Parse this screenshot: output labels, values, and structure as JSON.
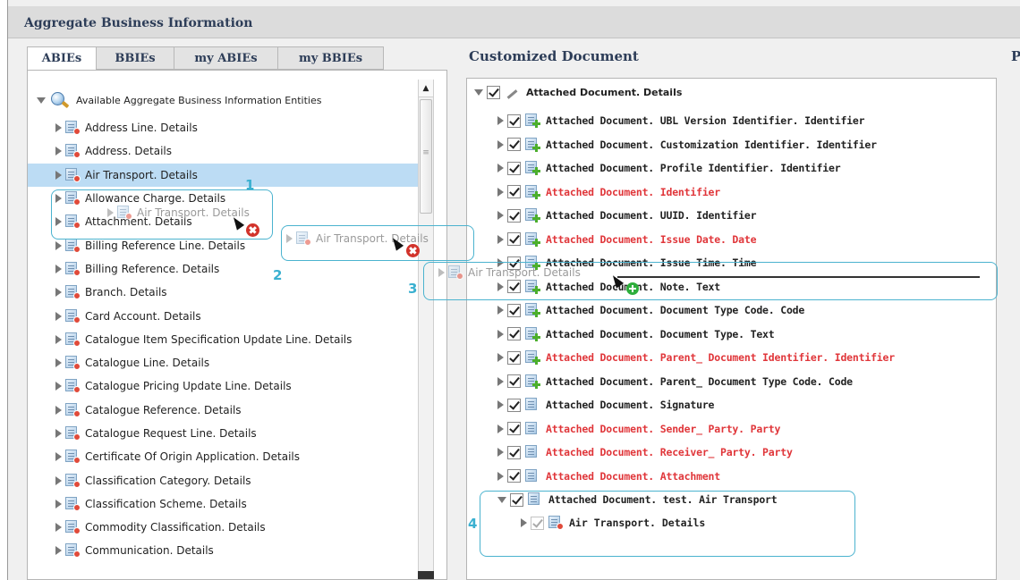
{
  "header": {
    "title": "Aggregate Business Information"
  },
  "tabs": [
    {
      "label": "ABIEs",
      "active": true
    },
    {
      "label": "BBIEs",
      "active": false
    },
    {
      "label": "my ABIEs",
      "active": false
    },
    {
      "label": "my BBIEs",
      "active": false
    }
  ],
  "left_tree": {
    "root_label": "Available Aggregate Business Information Entities",
    "items": [
      {
        "label": "Address Line. Details"
      },
      {
        "label": "Address. Details"
      },
      {
        "label": "Air Transport. Details",
        "selected": true
      },
      {
        "label": "Allowance Charge. Details"
      },
      {
        "label": "Attachment. Details"
      },
      {
        "label": "Billing Reference Line. Details"
      },
      {
        "label": "Billing Reference. Details"
      },
      {
        "label": "Branch. Details"
      },
      {
        "label": "Card Account. Details"
      },
      {
        "label": "Catalogue Item Specification Update Line. Details"
      },
      {
        "label": "Catalogue Line. Details"
      },
      {
        "label": "Catalogue Pricing Update Line. Details"
      },
      {
        "label": "Catalogue Reference. Details"
      },
      {
        "label": "Catalogue Request Line. Details"
      },
      {
        "label": "Certificate Of Origin Application. Details"
      },
      {
        "label": "Classification Category. Details"
      },
      {
        "label": "Classification Scheme. Details"
      },
      {
        "label": "Commodity Classification. Details"
      },
      {
        "label": "Communication. Details"
      }
    ]
  },
  "right_panel": {
    "title": "Customized Document",
    "edge_title": "P",
    "root_label": "Attached Document. Details",
    "items": [
      {
        "label": "Attached Document. UBL Version Identifier. Identifier",
        "required": false
      },
      {
        "label": "Attached Document. Customization Identifier. Identifier",
        "required": false
      },
      {
        "label": "Attached Document. Profile Identifier. Identifier",
        "required": false
      },
      {
        "label": "Attached Document. Identifier",
        "required": true
      },
      {
        "label": "Attached Document. UUID. Identifier",
        "required": false
      },
      {
        "label": "Attached Document. Issue Date. Date",
        "required": true
      },
      {
        "label": "Attached Document. Issue Time. Time",
        "required": false
      },
      {
        "label": "Attached Document. Note. Text",
        "required": false
      },
      {
        "label": "Attached Document. Document Type Code. Code",
        "required": false
      },
      {
        "label": "Attached Document. Document Type. Text",
        "required": false
      },
      {
        "label": "Attached Document. Parent_ Document Identifier. Identifier",
        "required": true
      },
      {
        "label": "Attached Document. Parent_ Document Type Code. Code",
        "required": false
      },
      {
        "label": "Attached Document. Signature",
        "required": false
      },
      {
        "label": "Attached Document. Sender_ Party. Party",
        "required": true
      },
      {
        "label": "Attached Document. Receiver_ Party. Party",
        "required": true
      },
      {
        "label": "Attached Document. Attachment",
        "required": true
      },
      {
        "label": "Attached Document. test. Air Transport",
        "required": false
      }
    ],
    "child_label": "Air Transport. Details"
  },
  "annotations": {
    "ghost_label": "Air Transport. Details",
    "step_numbers": [
      "1",
      "2",
      "3",
      "4"
    ],
    "annotation_color": "#4bb3cf"
  }
}
